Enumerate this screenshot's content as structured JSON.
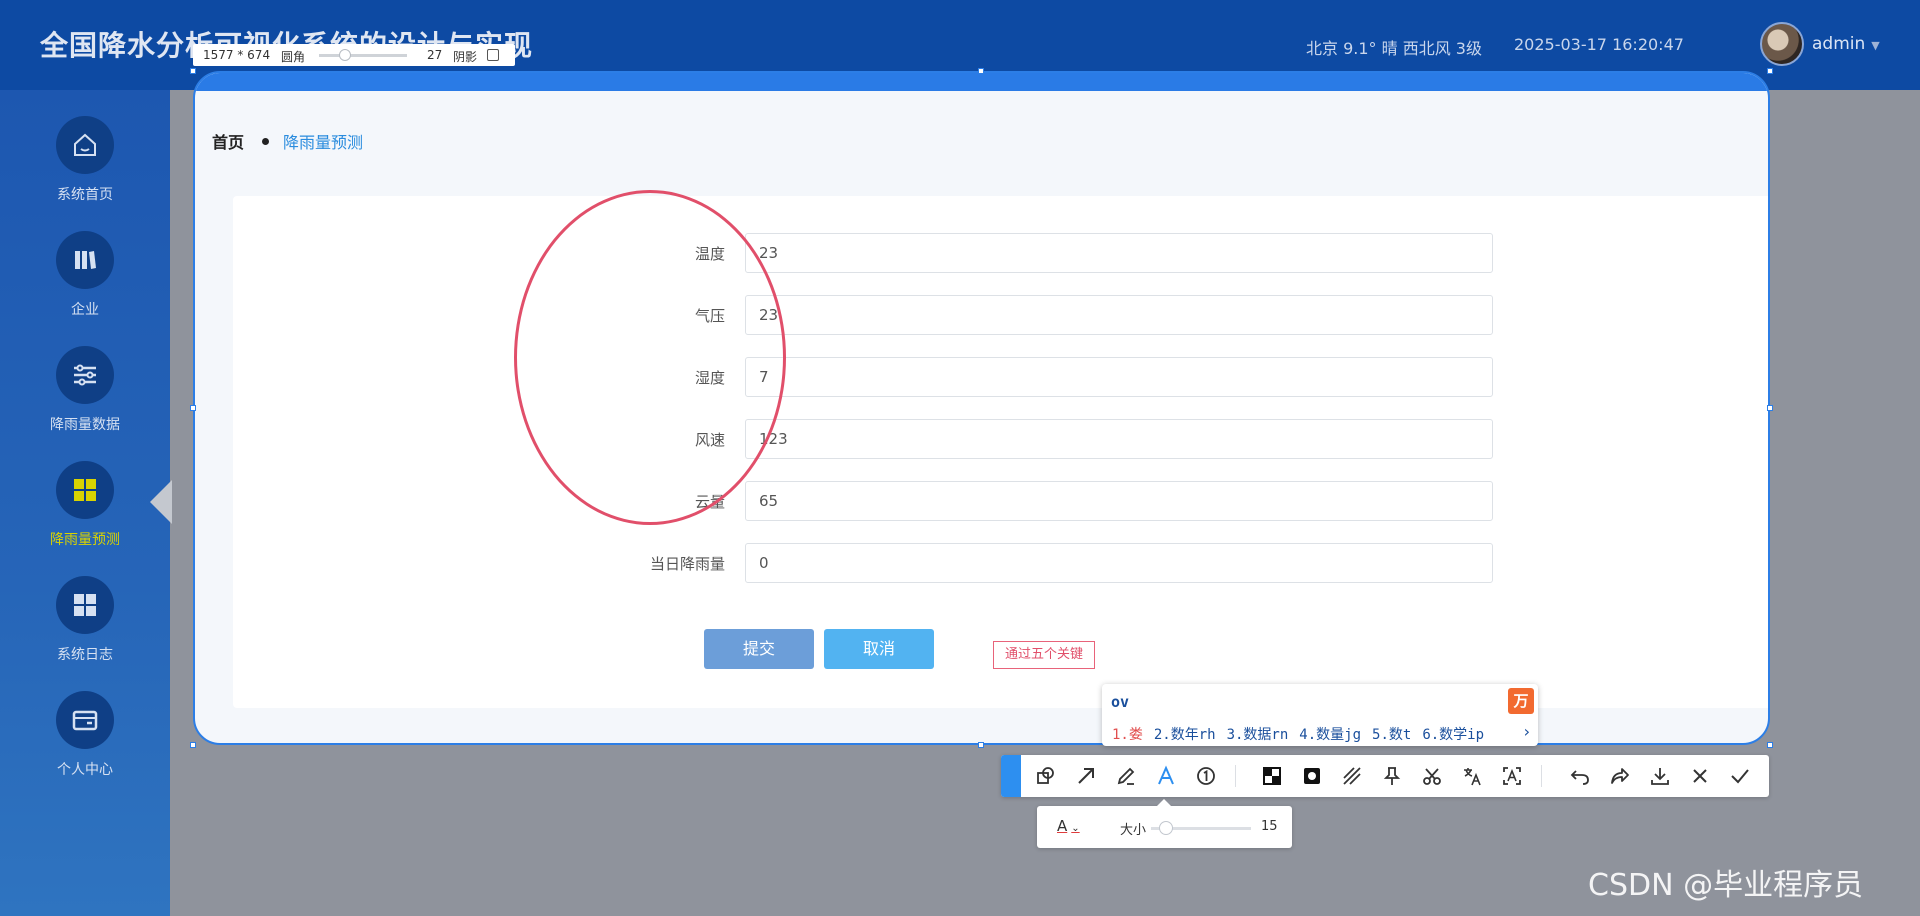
{
  "header": {
    "title": "全国降水分析可视化系统的设计与实现",
    "weather": "北京  9.1°  晴  西北风  3级",
    "datetime": "2025-03-17 16:20:47",
    "username": "admin"
  },
  "sidebar": {
    "items": [
      {
        "label": "系统首页",
        "icon": "home-icon"
      },
      {
        "label": "企业",
        "icon": "books-icon"
      },
      {
        "label": "降雨量数据",
        "icon": "sliders-icon"
      },
      {
        "label": "降雨量预测",
        "icon": "grid-icon",
        "active": true
      },
      {
        "label": "系统日志",
        "icon": "grid-icon"
      },
      {
        "label": "个人中心",
        "icon": "wallet-icon"
      }
    ],
    "active_color": "#d9d300"
  },
  "breadcrumb": {
    "home": "首页",
    "current": "降雨量预测"
  },
  "form": {
    "fields": [
      {
        "label": "温度",
        "value": "23"
      },
      {
        "label": "气压",
        "value": "23"
      },
      {
        "label": "湿度",
        "value": "7"
      },
      {
        "label": "风速",
        "value": "123"
      },
      {
        "label": "云量",
        "value": "65"
      },
      {
        "label": "当日降雨量",
        "value": "0"
      }
    ],
    "submit_label": "提交",
    "cancel_label": "取消"
  },
  "screenshot_tool": {
    "dimensions": "1577 * 674",
    "radius_label": "圆角",
    "radius_value": "27",
    "shadow_label": "阴影",
    "annotation_text": "通过五个关键",
    "size_label": "大小",
    "size_value": "15"
  },
  "ime": {
    "composition": "ov",
    "candidates": [
      "1.娄",
      "2.数年rh",
      "3.数据rn",
      "4.数量jg",
      "5.数t",
      "6.数学ip"
    ],
    "next": "›"
  },
  "watermark": "CSDN @毕业程序员",
  "colors": {
    "header_bg": "#0d4aa3",
    "frame_border": "#2c7ee6",
    "annotation": "#e14f6a",
    "submit_button": "#6c9ed9",
    "cancel_button": "#52b3f1"
  }
}
